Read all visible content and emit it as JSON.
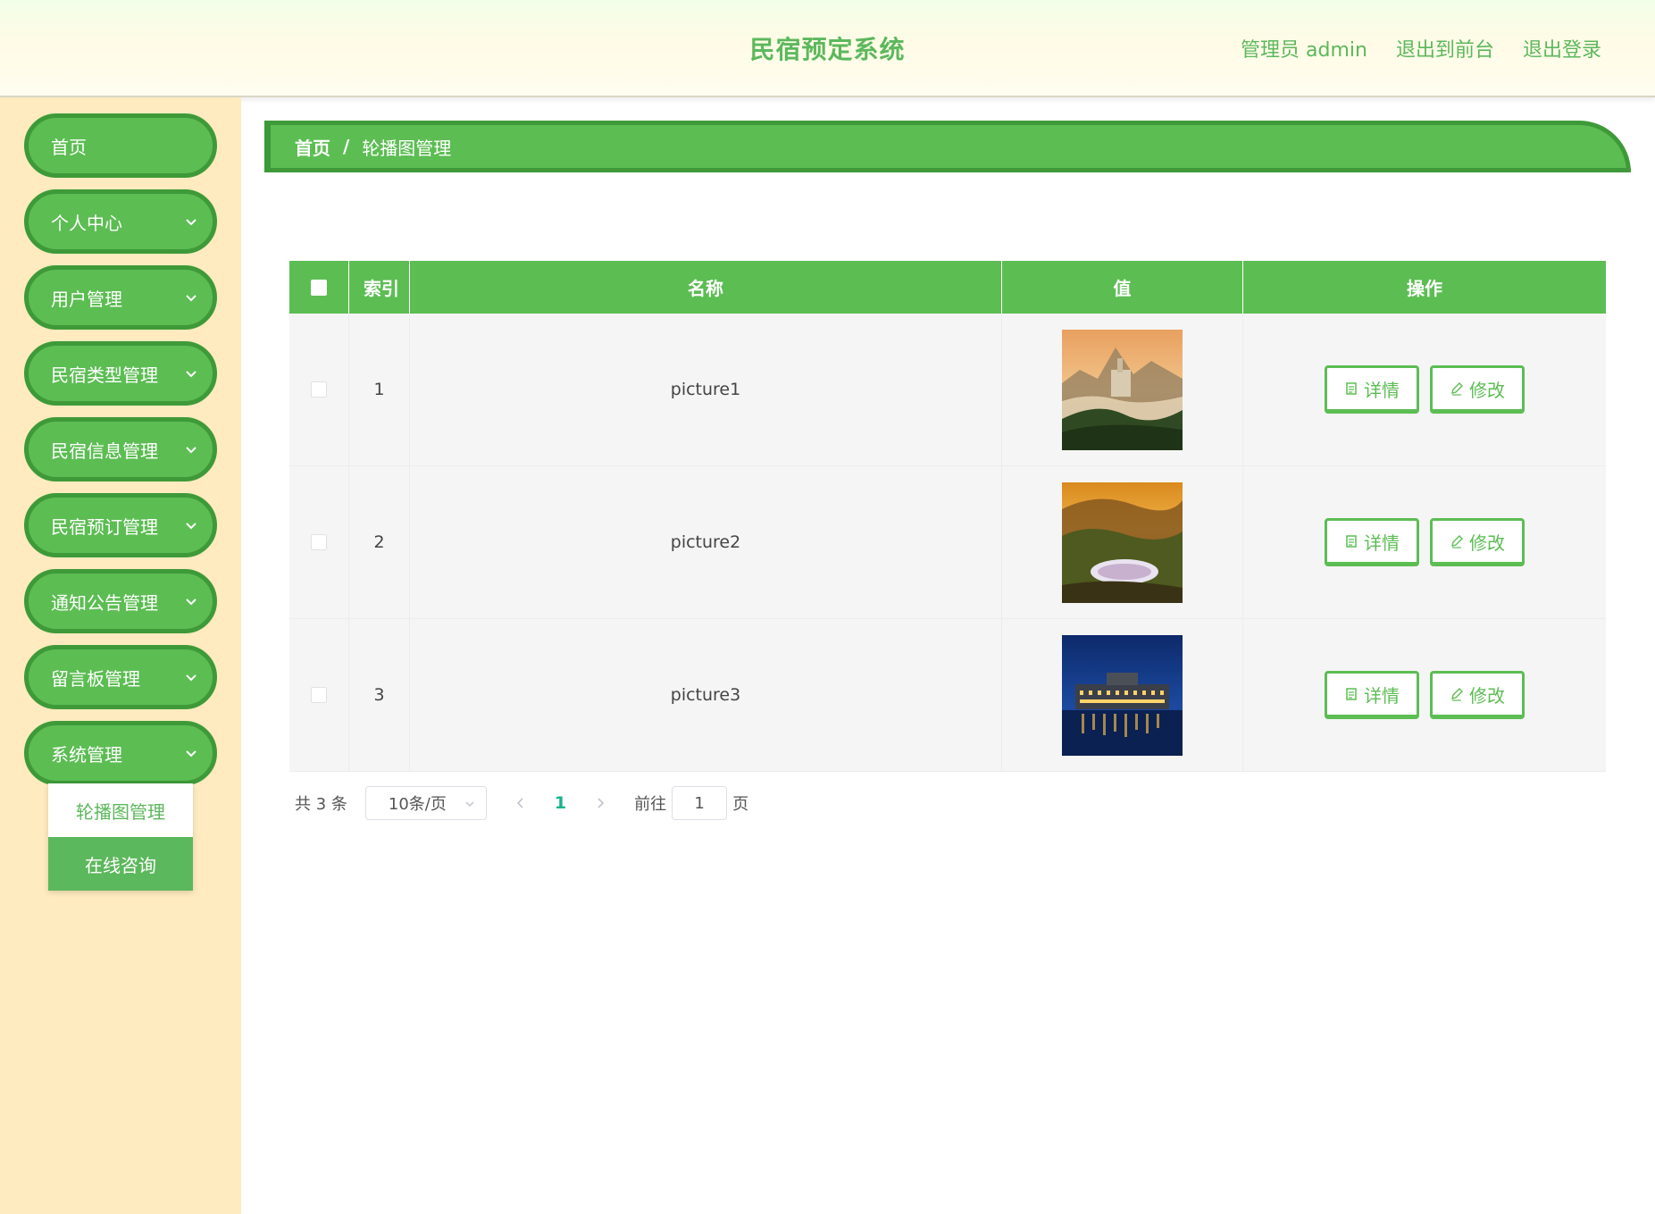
{
  "header": {
    "title": "民宿预定系统",
    "links": [
      "管理员 admin",
      "退出到前台",
      "退出登录"
    ]
  },
  "sidebar": {
    "items": [
      {
        "label": "首页"
      },
      {
        "label": "个人中心"
      },
      {
        "label": "用户管理"
      },
      {
        "label": "民宿类型管理"
      },
      {
        "label": "民宿信息管理"
      },
      {
        "label": "民宿预订管理"
      },
      {
        "label": "通知公告管理"
      },
      {
        "label": "留言板管理"
      },
      {
        "label": "系统管理"
      }
    ],
    "submenu": [
      {
        "label": "轮播图管理"
      },
      {
        "label": "在线咨询"
      }
    ]
  },
  "breadcrumb": {
    "home": "首页",
    "separator": "/",
    "current": "轮播图管理"
  },
  "table": {
    "columns": [
      "索引",
      "名称",
      "值",
      "操作"
    ],
    "rows": [
      {
        "index": "1",
        "name": "picture1"
      },
      {
        "index": "2",
        "name": "picture2"
      },
      {
        "index": "3",
        "name": "picture3"
      }
    ],
    "detail_label": "详情",
    "edit_label": "修改"
  },
  "pagination": {
    "total": "共 3 条",
    "page_size": "10条/页",
    "current_page": "1",
    "goto_label": "前往",
    "goto_value": "1",
    "page_suffix": "页"
  },
  "colors": {
    "accent": "#5cbd53",
    "accent_dark": "#3e9a38",
    "sidebar_bg": "#ffebbf",
    "page_active": "#15b48c"
  }
}
